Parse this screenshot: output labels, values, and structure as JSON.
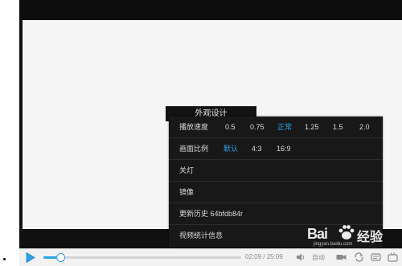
{
  "settings_tab": {
    "label": "外观设计"
  },
  "menu": {
    "speed": {
      "label": "播放速度",
      "options": [
        "0.5",
        "0.75",
        "正常",
        "1.25",
        "1.5",
        "2.0"
      ],
      "selected": "正常"
    },
    "ratio": {
      "label": "画面比例",
      "options": [
        "默认",
        "4:3",
        "16:9"
      ],
      "selected": "默认"
    },
    "lights_off": "关灯",
    "mirror": "镜像",
    "history": "更新历史 64bfdb84r",
    "stats": "视频统计信息"
  },
  "controls": {
    "current_time": "02:09",
    "separator": "/",
    "total_time": "25:09",
    "progress_fraction": 0.086,
    "quality": "自动"
  },
  "watermark": {
    "brand": "Bai",
    "cn": "经验",
    "url": "jingyan.baidu.com"
  },
  "colors": {
    "accent": "#2aa3ea",
    "menu_bg": "#181818",
    "video_bg": "#f5f5f5"
  }
}
